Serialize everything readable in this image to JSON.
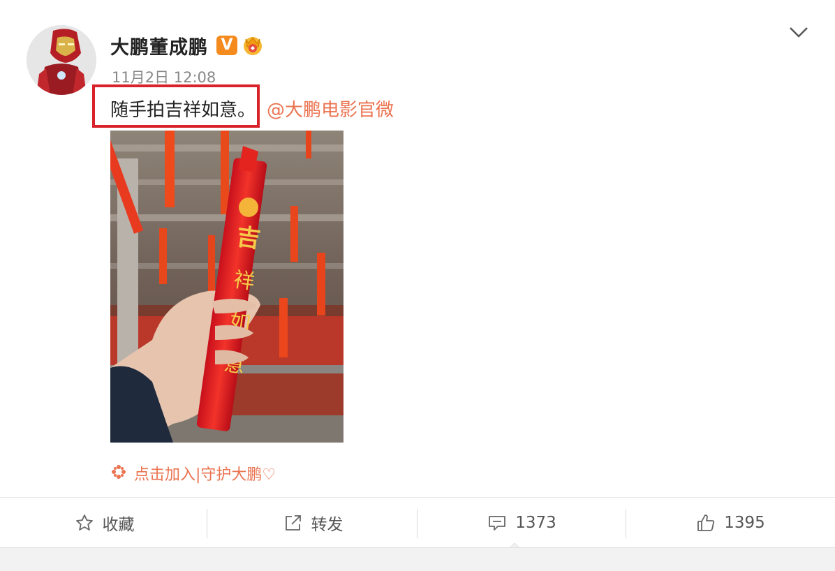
{
  "user": {
    "name": "大鹏董成鹏",
    "verified_badge": "V",
    "avatar_icon": "ironman-avatar",
    "badge_icon": "crown-badge-icon"
  },
  "post": {
    "time": "11月2日 12:08",
    "text": "随手拍吉祥如意。",
    "mention": "@大鹏电影官微",
    "image_icon": "candle-photo",
    "highlight_color": "#d8232a"
  },
  "super_topic": {
    "label": "点击加入|守护大鹏♡",
    "icon": "super-topic-icon"
  },
  "actions": {
    "favorite_label": "收藏",
    "repost_label": "转发",
    "comment_count": "1373",
    "like_count": "1395"
  },
  "colors": {
    "accent": "#eb7350",
    "verified": "#f58b1f",
    "text": "#222222",
    "muted": "#888888"
  }
}
